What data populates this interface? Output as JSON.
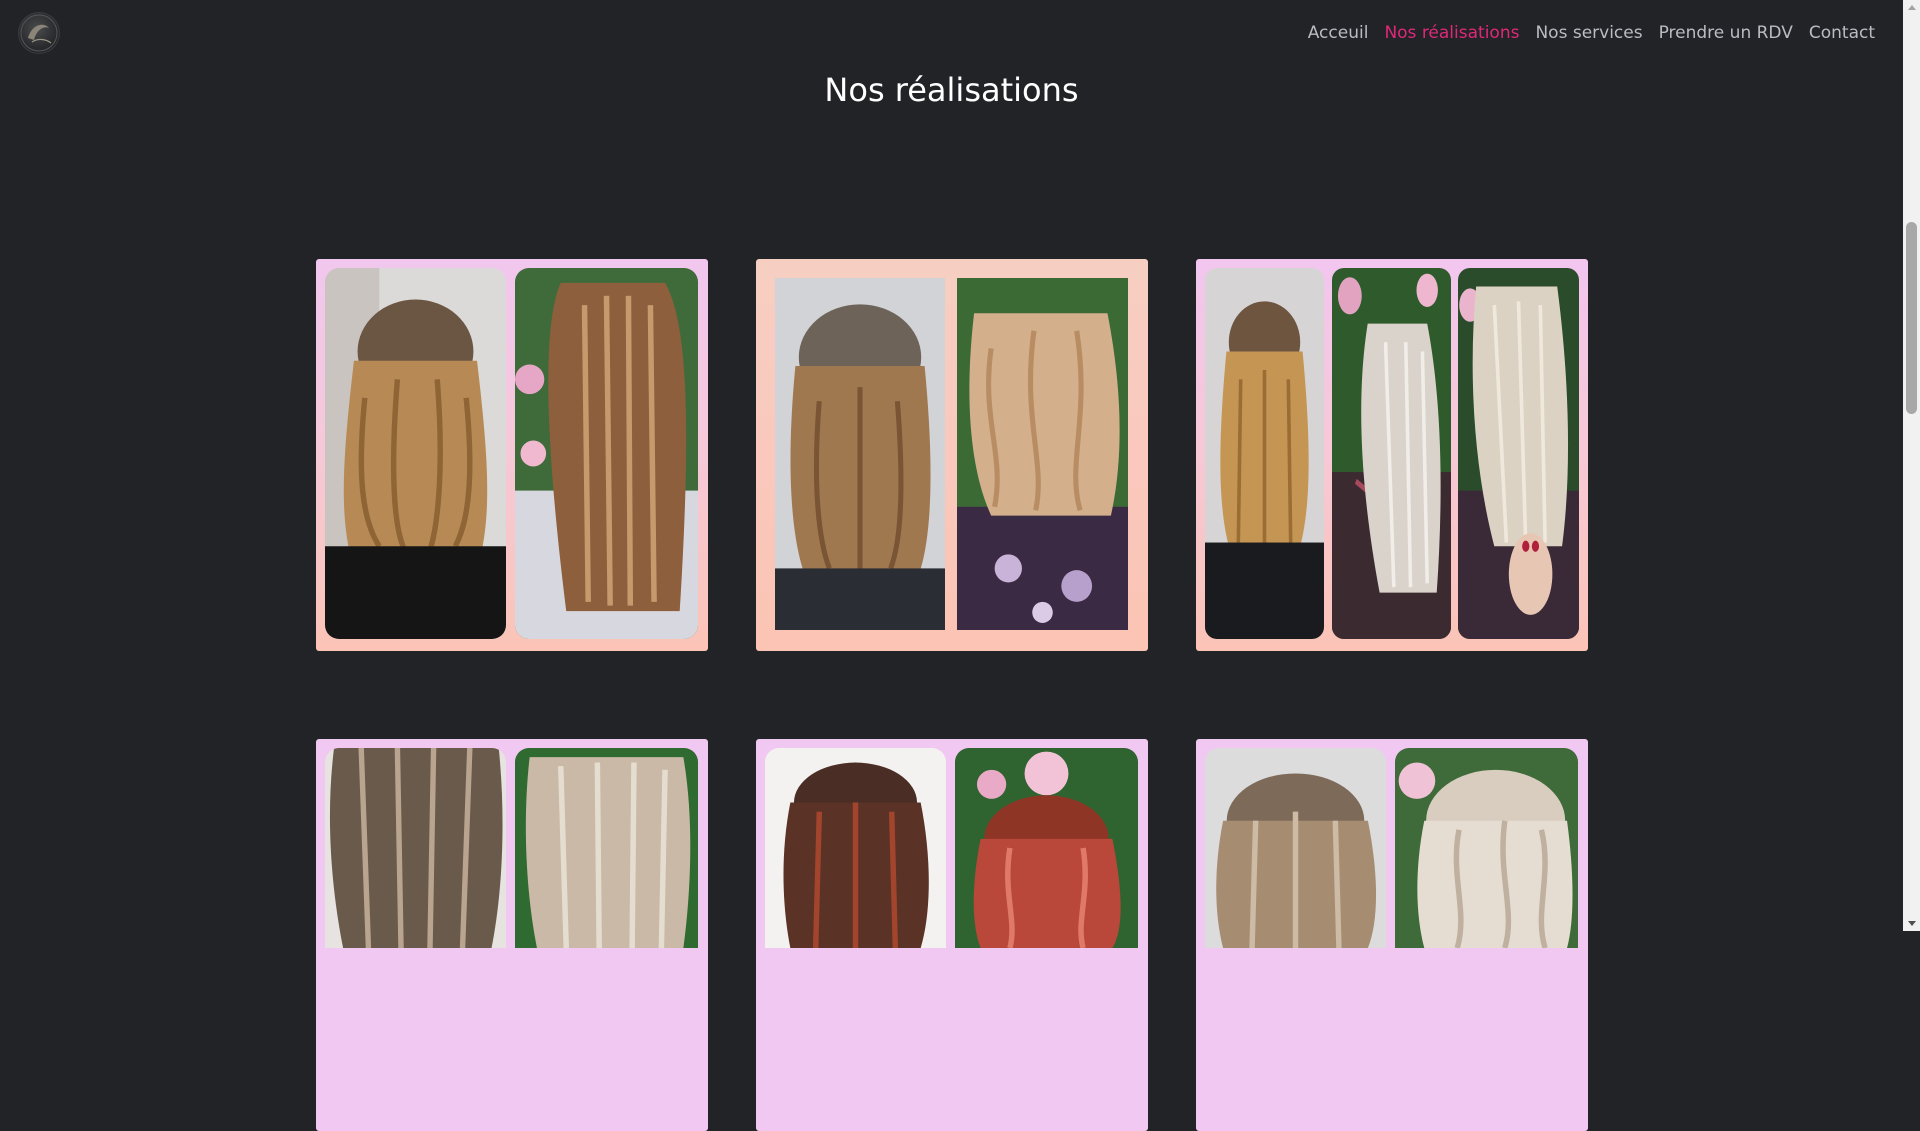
{
  "logo": {
    "icon": "salon-logo-icon"
  },
  "nav": {
    "items": [
      {
        "label": "Acceuil",
        "active": false
      },
      {
        "label": "Nos réalisations",
        "active": true
      },
      {
        "label": "Nos services",
        "active": false
      },
      {
        "label": "Prendre un RDV",
        "active": false
      },
      {
        "label": "Contact",
        "active": false
      }
    ],
    "active_color": "#e0287a",
    "text_color": "#b9bcc2"
  },
  "page": {
    "title": "Nos réalisations",
    "background": "#212327"
  },
  "gallery": {
    "cards": [
      {
        "photos": [
          "before-after-photo-1a",
          "before-after-photo-1b"
        ]
      },
      {
        "photos": [
          "before-after-photo-2a",
          "before-after-photo-2b"
        ]
      },
      {
        "photos": [
          "before-after-photo-3a",
          "before-after-photo-3b",
          "before-after-photo-3c"
        ]
      },
      {
        "photos": [
          "before-after-photo-4a",
          "before-after-photo-4b"
        ]
      },
      {
        "photos": [
          "before-after-photo-5a",
          "before-after-photo-5b"
        ]
      },
      {
        "photos": [
          "before-after-photo-6a",
          "before-after-photo-6b"
        ]
      }
    ]
  }
}
